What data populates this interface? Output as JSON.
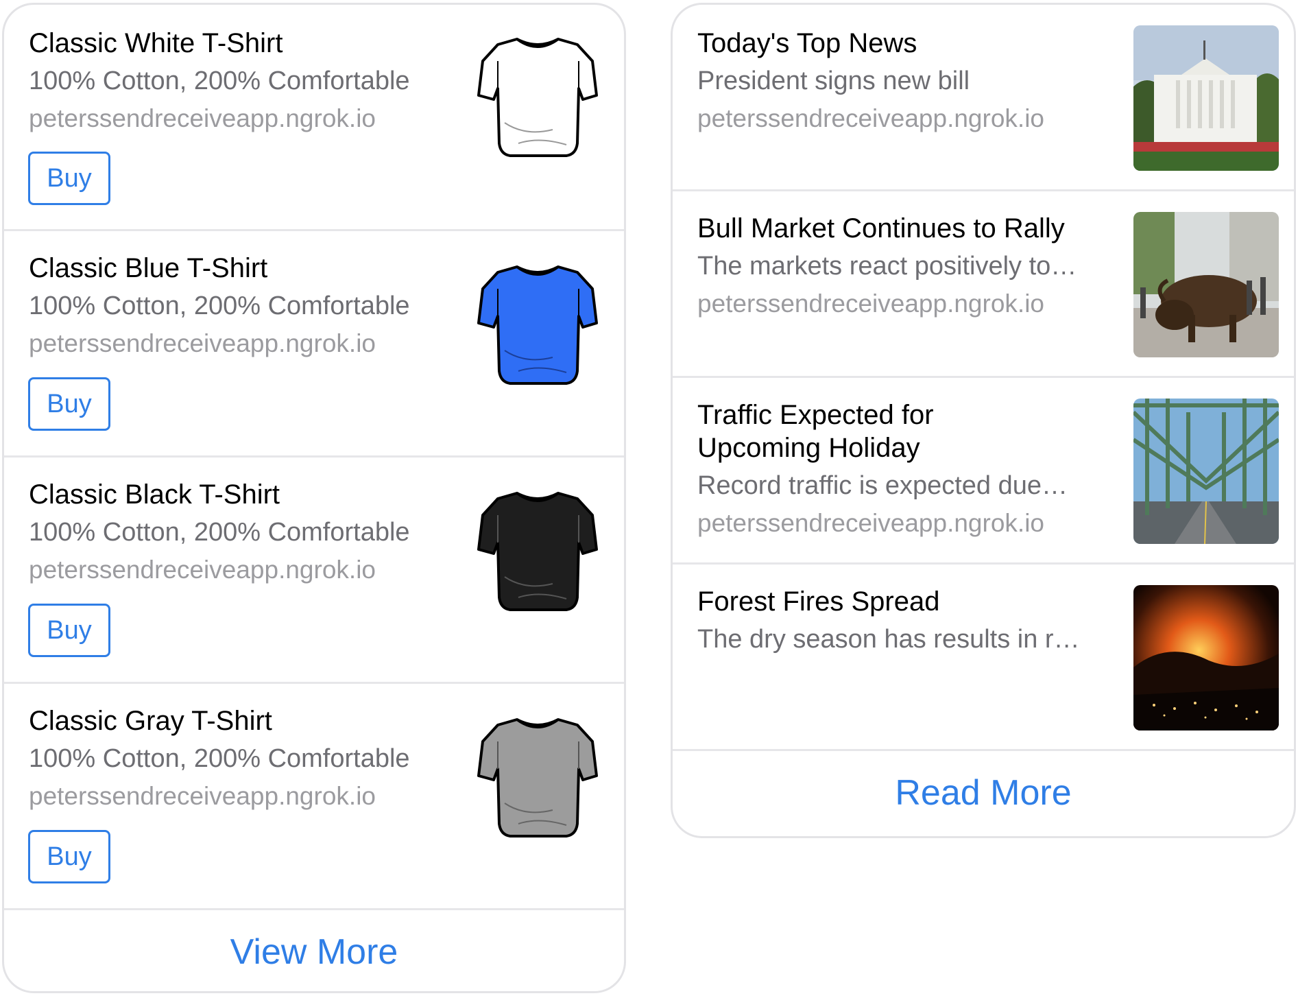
{
  "products": {
    "items": [
      {
        "title": "Classic White T-Shirt",
        "subtitle": "100% Cotton, 200% Comfortable",
        "url": "peterssendreceiveapp.ngrok.io",
        "button": "Buy",
        "color": "#ffffff",
        "image": "white-tshirt"
      },
      {
        "title": "Classic Blue T-Shirt",
        "subtitle": "100% Cotton, 200% Comfortable",
        "url": "peterssendreceiveapp.ngrok.io",
        "button": "Buy",
        "color": "#2f6ef5",
        "image": "blue-tshirt"
      },
      {
        "title": "Classic Black T-Shirt",
        "subtitle": "100% Cotton, 200% Comfortable",
        "url": "peterssendreceiveapp.ngrok.io",
        "button": "Buy",
        "color": "#1e1e1e",
        "image": "black-tshirt"
      },
      {
        "title": "Classic Gray T-Shirt",
        "subtitle": "100% Cotton, 200% Comfortable",
        "url": "peterssendreceiveapp.ngrok.io",
        "button": "Buy",
        "color": "#9c9c9c",
        "image": "gray-tshirt"
      }
    ],
    "footer_label": "View More"
  },
  "news": {
    "items": [
      {
        "title": "Today's Top News",
        "subtitle": "President signs new bill",
        "url": "peterssendreceiveapp.ngrok.io",
        "image": "white-house-photo"
      },
      {
        "title": "Bull Market Continues to Rally",
        "subtitle": "The markets react positively to…",
        "url": "peterssendreceiveapp.ngrok.io",
        "image": "charging-bull-photo"
      },
      {
        "title_line1": "Traffic Expected for",
        "title_line2": "Upcoming Holiday",
        "subtitle": "Record traffic is expected due…",
        "url": "peterssendreceiveapp.ngrok.io",
        "image": "bridge-photo"
      },
      {
        "title": "Forest Fires Spread",
        "subtitle": "The dry season has results in r…",
        "image": "forest-fire-photo"
      }
    ],
    "footer_label": "Read More"
  },
  "colors": {
    "accent": "#2f7ee6",
    "title": "#000000",
    "subtitle": "#6d6d72",
    "url": "#9b9b9f",
    "divider": "#e6e6e9"
  }
}
